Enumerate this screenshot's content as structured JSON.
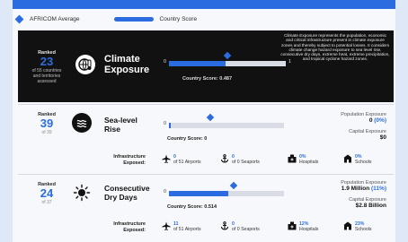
{
  "legend": {
    "average_label": "AFRICOM Average",
    "country_label": "Country Score"
  },
  "colors": {
    "accent": "#2b6de0",
    "dark": "#111111",
    "track": "#d9dce4"
  },
  "cards": [
    {
      "rank_label": "Ranked",
      "rank": "23",
      "rank_sub_1": "of 55 countries",
      "rank_sub_2": "and territories",
      "rank_sub_3": "assessed",
      "title_1": "Climate",
      "title_2": "Exposure",
      "icon": "globe-thermometer-icon",
      "bar_min": "0",
      "bar_max": "1",
      "score_label": "Country Score: 0.487",
      "score_value": 0.487,
      "average_value": 0.5,
      "description": "Climate Exposure represents the population, economic and critical infrastructure present in climate exposure zones and thereby subject to potential losses. It considers climate change hazard exposure to sea level rise, consecutive dry days, extreme heat, extreme precipitation, and tropical cyclone hazard zones."
    },
    {
      "rank_label": "Ranked",
      "rank": "39",
      "rank_sub_1": "of 39",
      "title_1": "Sea-level",
      "title_2": "Rise",
      "icon": "waves-icon",
      "bar_min": "0",
      "score_label": "Country Score: 0",
      "score_value": 0,
      "average_value": 0.36,
      "pop_label": "Population Exposure",
      "pop_value": "0",
      "pop_pct": "(0%)",
      "cap_label": "Capital Exposure",
      "cap_value": "$0",
      "infra_title_1": "Infrastructure",
      "infra_title_2": "Exposed:",
      "airports_val": "0",
      "airports_txt": "of 51 Airports",
      "seaports_val": "0",
      "seaports_txt": "of 0 Seaports",
      "hospitals_val": "0%",
      "hospitals_txt": "Hospitals",
      "schools_val": "0%",
      "schools_txt": "Schools"
    },
    {
      "rank_label": "Ranked",
      "rank": "24",
      "rank_sub_1": "of 37",
      "title_1": "Consecutive",
      "title_2": "Dry Days",
      "icon": "sun-icon",
      "bar_min": "0",
      "score_label": "Country Score: 0.514",
      "score_value": 0.514,
      "average_value": 0.56,
      "pop_label": "Population Exposure",
      "pop_value": "1.9 Million",
      "pop_pct": "(11%)",
      "cap_label": "Capital Exposure",
      "cap_value": "$2.8 Billion",
      "infra_title_1": "Infrastructure",
      "infra_title_2": "Exposed:",
      "airports_val": "11",
      "airports_txt": "of 51 Airports",
      "seaports_val": "0",
      "seaports_txt": "of 0 Seaports",
      "hospitals_val": "12%",
      "hospitals_txt": "Hospitals",
      "schools_val": "23%",
      "schools_txt": "Schools"
    }
  ]
}
